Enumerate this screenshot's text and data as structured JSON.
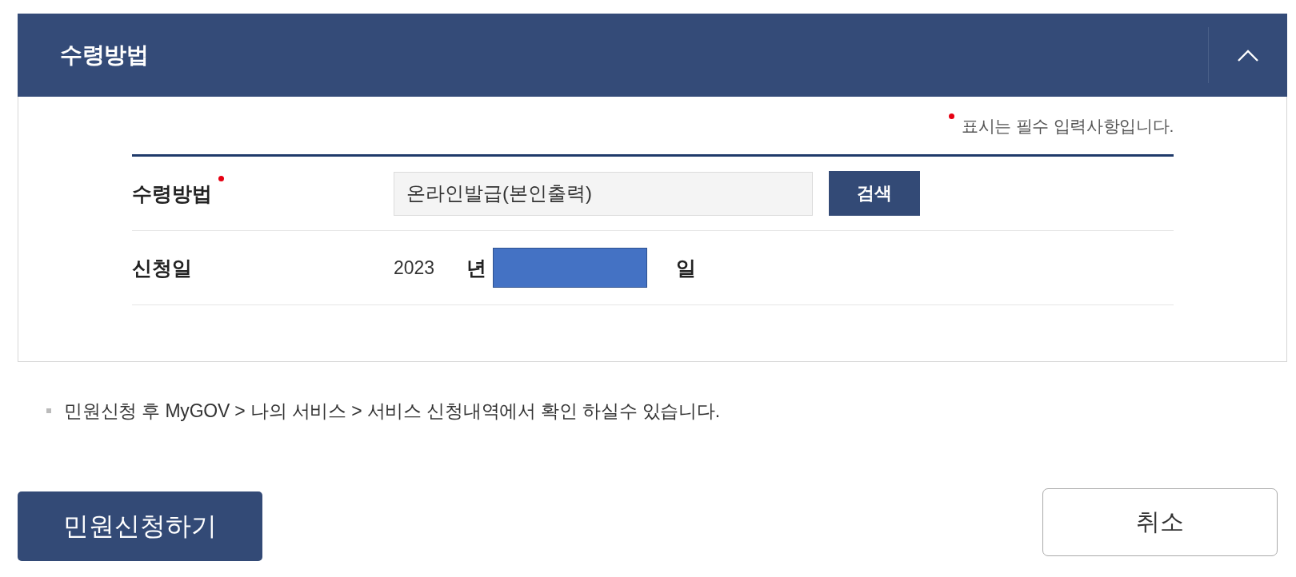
{
  "section": {
    "title": "수령방법",
    "expanded": true
  },
  "required_note": "표시는 필수 입력사항입니다.",
  "form": {
    "rows": [
      {
        "kind": "search_field",
        "label": "수령방법",
        "required": true,
        "value": "온라인발급(본인출력)",
        "button": "검색"
      },
      {
        "kind": "date",
        "label": "신청일",
        "required": false,
        "year": "2023",
        "year_unit": "년",
        "month_redacted": true,
        "day_unit": "일"
      }
    ]
  },
  "notice": "민원신청 후 MyGOV > 나의 서비스 > 서비스 신청내역에서 확인 하실수 있습니다.",
  "buttons": [
    {
      "kind": "primary",
      "label": "민원신청하기"
    },
    {
      "kind": "secondary",
      "label": "취소"
    }
  ]
}
